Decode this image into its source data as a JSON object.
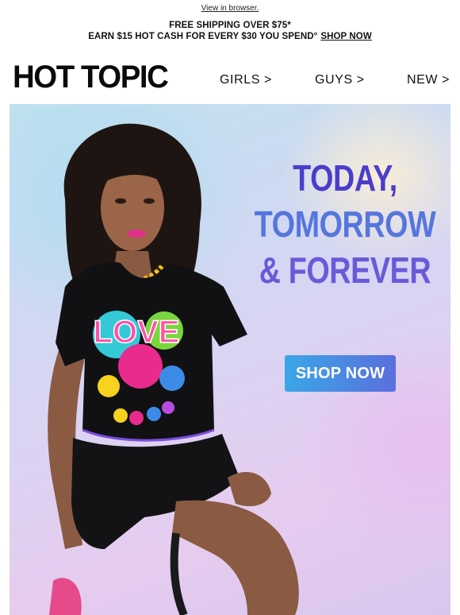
{
  "preheader": {
    "view_in_browser": "View in browser."
  },
  "promo": {
    "line1": "FREE SHIPPING OVER $75*",
    "line2": "EARN $15 HOT CASH FOR EVERY $30 YOU SPEND°",
    "shop_now_link": "SHOP NOW"
  },
  "header": {
    "logo": "HOT TOPIC",
    "nav": [
      {
        "label": "GIRLS >"
      },
      {
        "label": "GUYS >"
      },
      {
        "label": "NEW >"
      }
    ]
  },
  "hero": {
    "headline_line1": "TODAY,",
    "headline_line2": "TOMORROW",
    "headline_line3": "& FOREVER",
    "cta_label": "SHOP NOW",
    "shirt_text": "LOVE",
    "colors": {
      "headline_dark": "#4a3dcc",
      "headline_mid": "#5576dc",
      "cta_start": "#3aa6e8",
      "cta_end": "#5a6fdd"
    }
  }
}
